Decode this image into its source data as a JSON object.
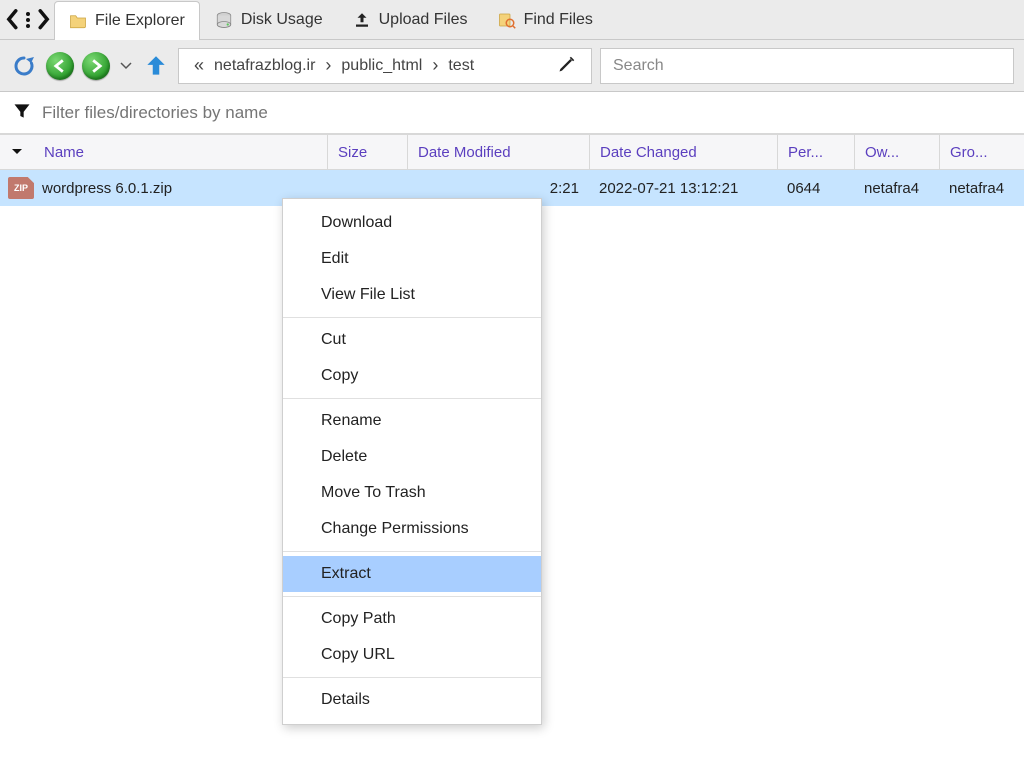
{
  "tabs": [
    {
      "label": "File Explorer"
    },
    {
      "label": "Disk Usage"
    },
    {
      "label": "Upload Files"
    },
    {
      "label": "Find Files"
    }
  ],
  "breadcrumb": {
    "items": [
      "netafrazblog.ir",
      "public_html",
      "test"
    ]
  },
  "search": {
    "placeholder": "Search"
  },
  "filter": {
    "placeholder": "Filter files/directories by name"
  },
  "columns": {
    "name": "Name",
    "size": "Size",
    "modified": "Date Modified",
    "changed": "Date Changed",
    "perm": "Per...",
    "owner": "Ow...",
    "group": "Gro..."
  },
  "rows": [
    {
      "name": "wordpress 6.0.1.zip",
      "size": "",
      "modified_visible": "2:21",
      "changed": "2022-07-21 13:12:21",
      "perm": "0644",
      "owner": "netafra4",
      "group": "netafra4",
      "zip_label": "ZIP"
    }
  ],
  "contextMenu": {
    "items": [
      {
        "label": "Download"
      },
      {
        "label": "Edit"
      },
      {
        "label": "View File List"
      },
      {
        "sep": true
      },
      {
        "label": "Cut"
      },
      {
        "label": "Copy"
      },
      {
        "sep": true
      },
      {
        "label": "Rename"
      },
      {
        "label": "Delete"
      },
      {
        "label": "Move To Trash"
      },
      {
        "label": "Change Permissions"
      },
      {
        "sep": true
      },
      {
        "label": "Extract",
        "highlighted": true
      },
      {
        "sep": true
      },
      {
        "label": "Copy Path"
      },
      {
        "label": "Copy URL"
      },
      {
        "sep": true
      },
      {
        "label": "Details"
      }
    ]
  }
}
